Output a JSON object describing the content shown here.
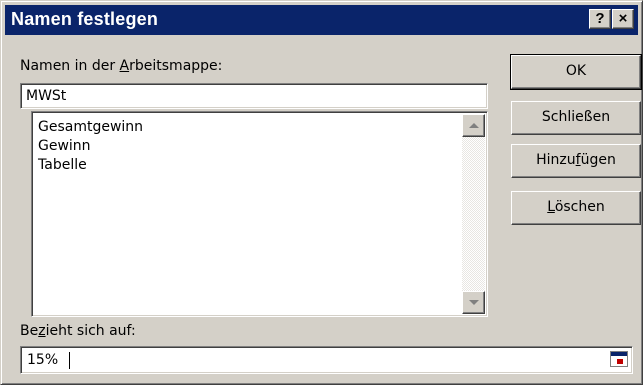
{
  "window": {
    "title": "Namen festlegen",
    "help_button": "?",
    "close_button": "×"
  },
  "names_label": {
    "before": "Namen in der ",
    "accel": "A",
    "after": "rbeitsmappe:"
  },
  "name_input": {
    "value": "MWSt"
  },
  "names_list": {
    "items": [
      "Gesamtgewinn",
      "Gewinn",
      "Tabelle"
    ]
  },
  "refers_label": {
    "before": "Be",
    "accel": "z",
    "after": "ieht sich auf:"
  },
  "refers_input": {
    "value": "15%"
  },
  "buttons": {
    "ok": "OK",
    "close": "Schließen",
    "add": {
      "before": "Hinzu",
      "accel": "f",
      "after": "ügen"
    },
    "delete": {
      "before": "",
      "accel": "L",
      "after": "öschen"
    }
  },
  "colors": {
    "titlebar": "#0a246a",
    "dialog": "#d4d0c8"
  }
}
